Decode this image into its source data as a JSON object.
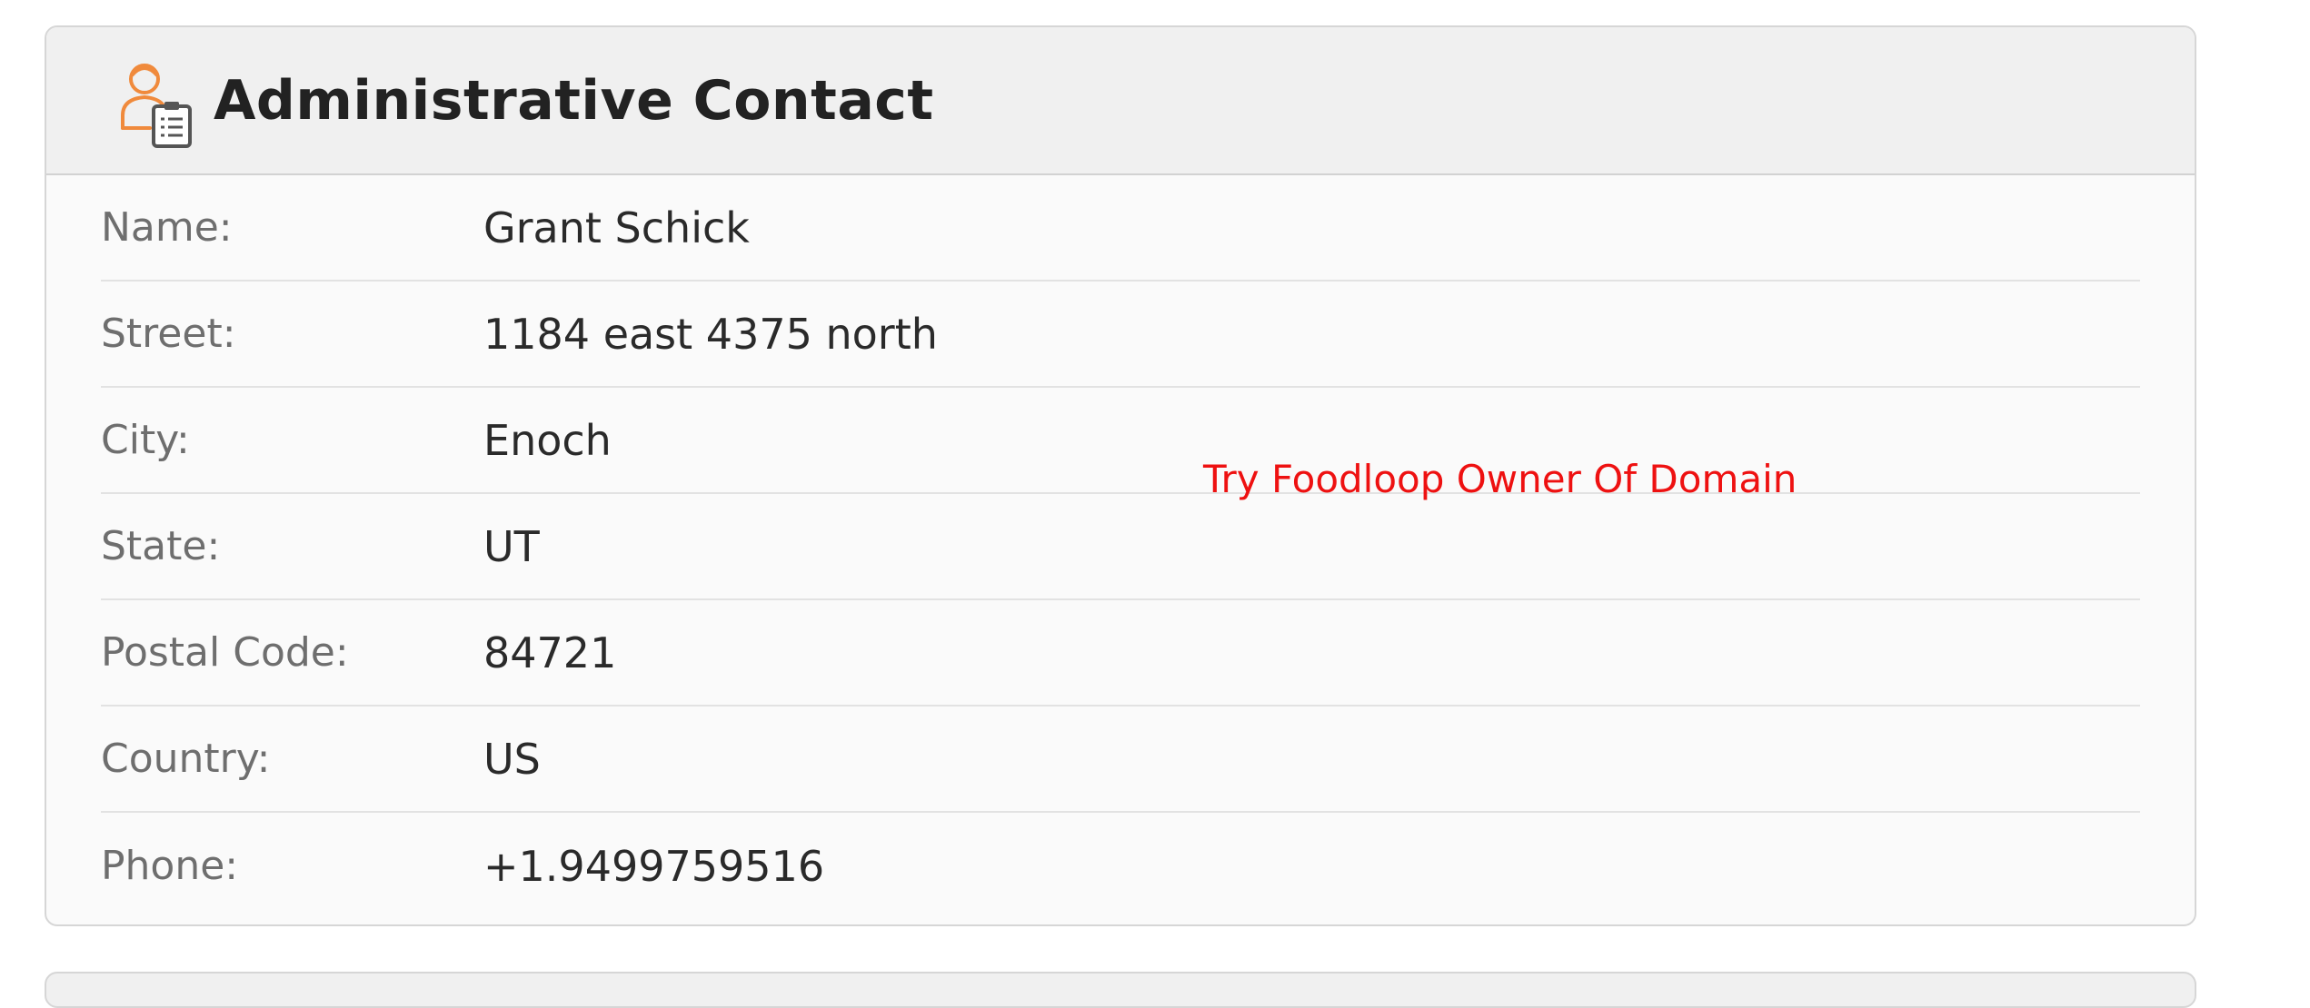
{
  "card": {
    "title": "Administrative Contact",
    "icon": "admin-contact-icon",
    "accent_color": "#f08a3c",
    "rows": [
      {
        "label": "Name:",
        "value": "Grant Schick"
      },
      {
        "label": "Street:",
        "value": "1184 east 4375 north"
      },
      {
        "label": "City:",
        "value": "Enoch"
      },
      {
        "label": "State:",
        "value": "UT"
      },
      {
        "label": "Postal Code:",
        "value": "84721"
      },
      {
        "label": "Country:",
        "value": "US"
      },
      {
        "label": "Phone:",
        "value": "+1.9499759516"
      }
    ]
  },
  "promo": {
    "text": "Try Foodloop Owner Of Domain",
    "color": "#ee1111"
  }
}
